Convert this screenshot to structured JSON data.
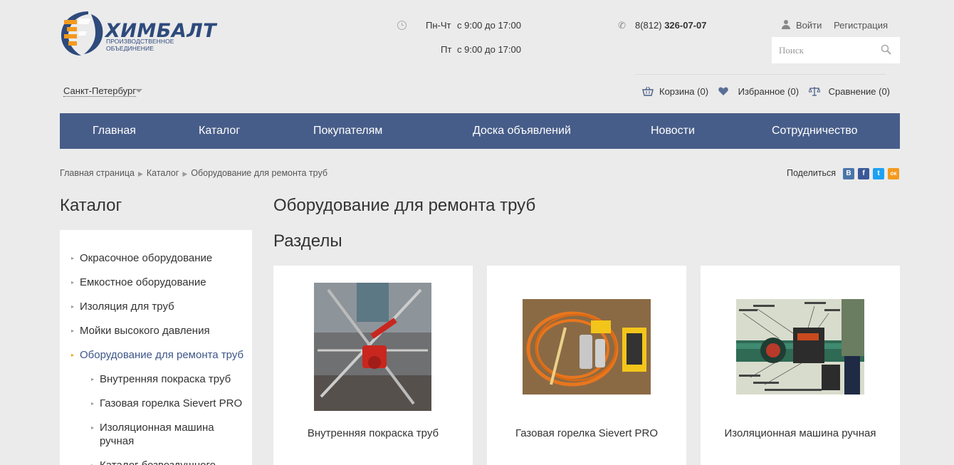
{
  "logo": {
    "name": "ХИМБАЛТ",
    "tagline": "ПРОИЗВОДСТВЕННОЕ ОБЪЕДИНЕНИЕ"
  },
  "hours": [
    {
      "days": "Пн-Чт",
      "time": "с 9:00 до 17:00"
    },
    {
      "days": "Пт",
      "time": "с 9:00 до 17:00"
    }
  ],
  "phone": {
    "prefix": "8(812)",
    "number": "326-07-07"
  },
  "auth": {
    "login": "Войти",
    "register": "Регистрация"
  },
  "search": {
    "placeholder": "Поиск"
  },
  "city": "Санкт-Петербург",
  "userbar": {
    "cart": "Корзина (0)",
    "favorites": "Избранное (0)",
    "compare": "Сравнение (0)"
  },
  "nav": [
    "Главная",
    "Каталог",
    "Покупателям",
    "Доска объявлений",
    "Новости",
    "Сотрудничество"
  ],
  "breadcrumb": [
    "Главная страница",
    "Каталог",
    "Оборудование для ремонта труб"
  ],
  "share": {
    "label": "Поделиться",
    "buttons": [
      "В",
      "f",
      "t",
      "ок"
    ]
  },
  "sidebar": {
    "title": "Каталог",
    "items": [
      "Окрасочное оборудование",
      "Емкостное оборудование",
      "Изоляция для труб",
      "Мойки высокого давления",
      "Оборудование для ремонта труб"
    ],
    "subitems": [
      "Внутренняя покраска труб",
      "Газовая горелка Sievert PRO",
      "Изоляционная машина ручная",
      "Каталог безвоздушного"
    ]
  },
  "main": {
    "title": "Оборудование для ремонта труб",
    "sections_title": "Разделы",
    "cards": [
      "Внутренняя покраска труб",
      "Газовая горелка Sievert PRO",
      "Изоляционная машина ручная"
    ]
  },
  "colors": {
    "nav_bg": "#475d89",
    "brand": "#2e4a7c",
    "accent": "#e8a317",
    "page_bg": "#ebebeb"
  }
}
